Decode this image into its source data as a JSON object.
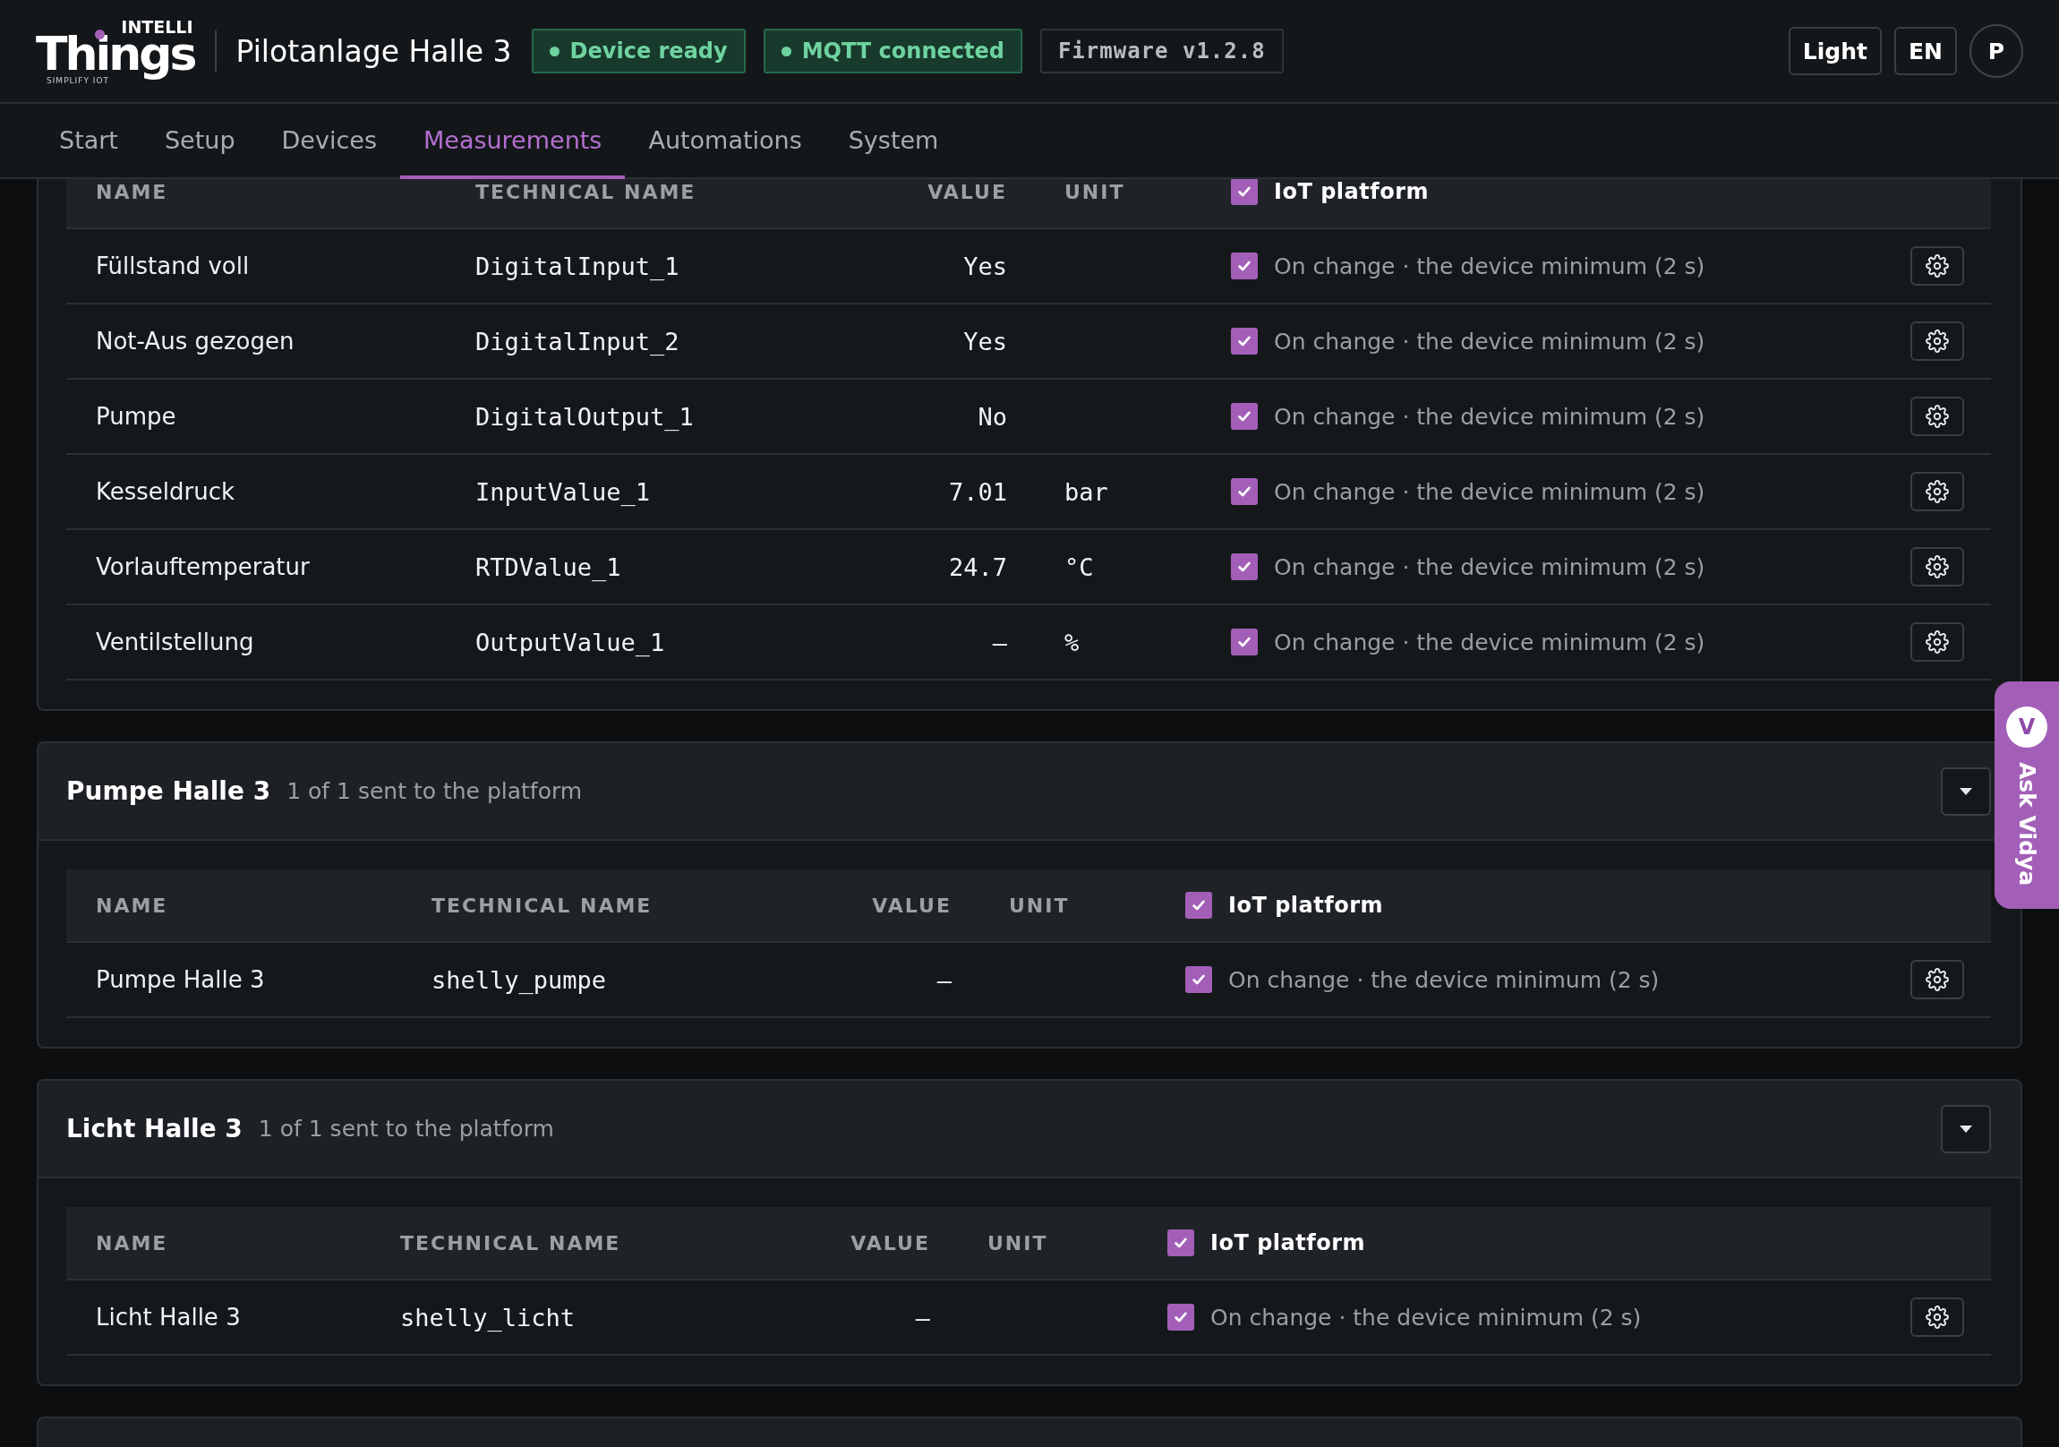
{
  "header": {
    "logo": {
      "top": "INTELLI",
      "main": "Things",
      "tagline": "SIMPLIFY IOT"
    },
    "title": "Pilotanlage Halle 3",
    "badges": [
      {
        "kind": "status",
        "label": "Device ready"
      },
      {
        "kind": "status",
        "label": "MQTT connected"
      },
      {
        "kind": "version",
        "label": "Firmware v1.2.8"
      }
    ],
    "actions": [
      {
        "kind": "button",
        "label": "Light"
      },
      {
        "kind": "button",
        "label": "EN"
      },
      {
        "kind": "avatar",
        "label": "P"
      }
    ]
  },
  "tabs": [
    {
      "label": "Start",
      "selected": false
    },
    {
      "label": "Setup",
      "selected": false
    },
    {
      "label": "Devices",
      "selected": false
    },
    {
      "label": "Measurements",
      "selected": true
    },
    {
      "label": "Automations",
      "selected": false
    },
    {
      "label": "System",
      "selected": false
    }
  ],
  "sections": [
    {
      "columns": [
        "NAME",
        "TECHNICAL NAME",
        "VALUE",
        "UNIT"
      ],
      "platform_header": {
        "label": "IoT platform",
        "checked": true
      },
      "rows": [
        {
          "name": "Füllstand voll",
          "technical_name": "DigitalInput_1",
          "value": "Yes",
          "sent": true,
          "schedule": "On change · the device minimum (2 s)"
        },
        {
          "name": "Not-Aus gezogen",
          "technical_name": "DigitalInput_2",
          "value": "Yes",
          "sent": true,
          "schedule": "On change · the device minimum (2 s)"
        },
        {
          "name": "Pumpe",
          "technical_name": "DigitalOutput_1",
          "value": "No",
          "sent": true,
          "schedule": "On change · the device minimum (2 s)"
        },
        {
          "name": "Kesseldruck",
          "technical_name": "InputValue_1",
          "value": "7.01",
          "unit": "bar",
          "sent": true,
          "schedule": "On change · the device minimum (2 s)"
        },
        {
          "name": "Vorlauftemperatur",
          "technical_name": "RTDValue_1",
          "value": "24.7",
          "unit": "°C",
          "sent": true,
          "schedule": "On change · the device minimum (2 s)"
        },
        {
          "name": "Ventilstellung",
          "technical_name": "OutputValue_1",
          "value": "–",
          "unit": "%",
          "sent": true,
          "schedule": "On change · the device minimum (2 s)"
        }
      ]
    },
    {
      "title": "Pumpe Halle 3",
      "summary": "1 of 1 sent to the platform",
      "columns": [
        "NAME",
        "TECHNICAL NAME",
        "VALUE",
        "UNIT"
      ],
      "platform_header": {
        "label": "IoT platform",
        "checked": true
      },
      "rows": [
        {
          "name": "Pumpe Halle 3",
          "technical_name": "shelly_pumpe",
          "value": "–",
          "sent": true,
          "schedule": "On change · the device minimum (2 s)"
        }
      ]
    },
    {
      "title": "Licht Halle 3",
      "summary": "1 of 1 sent to the platform",
      "columns": [
        "NAME",
        "TECHNICAL NAME",
        "VALUE",
        "UNIT"
      ],
      "platform_header": {
        "label": "IoT platform",
        "checked": true
      },
      "rows": [
        {
          "name": "Licht Halle 3",
          "technical_name": "shelly_licht",
          "value": "–",
          "sent": true,
          "schedule": "On change · the device minimum (2 s)"
        }
      ]
    }
  ],
  "assistant": {
    "avatar": "V",
    "label": "Ask Vidya"
  }
}
